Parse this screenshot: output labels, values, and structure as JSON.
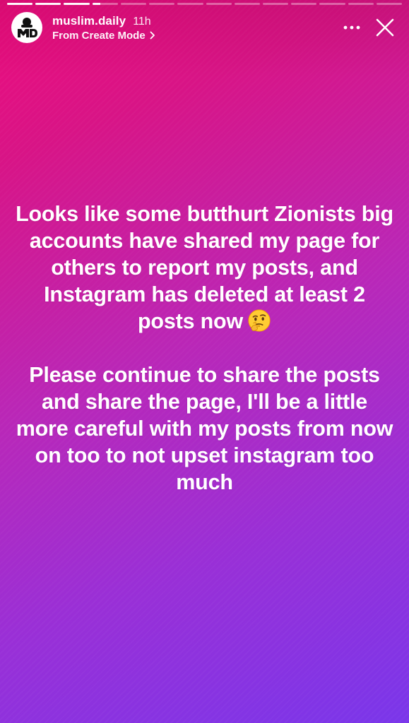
{
  "story": {
    "progress_segments": [
      1,
      1,
      1,
      0.3,
      0,
      0,
      0,
      0,
      0,
      0,
      0,
      0,
      0,
      0
    ],
    "header": {
      "username": "muslim.daily",
      "time_ago": "11h",
      "subtitle": "From Create Mode",
      "avatar_initials": "MD"
    },
    "body": {
      "paragraph_1": "Looks like some butthurt Zionists big accounts have shared my page for others to report my posts, and Instagram has deleted at least 2 posts now",
      "paragraph_1_emoji": "thinking-face",
      "paragraph_2": "Please continue to share the posts and share the page, I'll be a little more careful with my posts from now on too to not upset instagram too much"
    },
    "colors": {
      "gradient_top": "#ee0c7c",
      "gradient_mid": "#b927b8",
      "gradient_bottom": "#7a36ea",
      "text": "#ffffff"
    },
    "icons": {
      "more": "more-horizontal-icon",
      "close": "close-icon",
      "chevron": "chevron-right-icon"
    }
  }
}
